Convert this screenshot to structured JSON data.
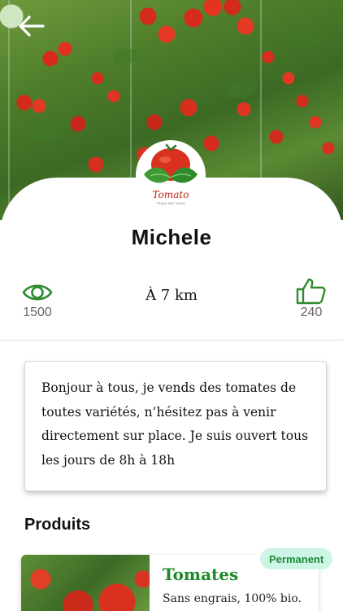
{
  "header": {
    "back_icon": "arrow-left-icon",
    "logo": {
      "brand": "Tomato",
      "tagline": "TRADLINE FARM"
    }
  },
  "profile": {
    "name": "Michele",
    "views_icon": "eye-icon",
    "views": "1500",
    "distance": "À 7 km",
    "likes_icon": "thumbs-up-icon",
    "likes": "240"
  },
  "description": {
    "lines": [
      "Bonjour à tous, je vends des tomates de",
      "toutes variétés, n’hésitez pas à venir",
      "directement sur place. Je suis ouvert tous",
      "les jours de 8h à 18h"
    ]
  },
  "products": {
    "title": "Produits",
    "items": [
      {
        "name": "Tomates",
        "description": "Sans engrais, 100% bio.",
        "badge": "Permanent"
      }
    ]
  },
  "colors": {
    "accent_green": "#1f8a2a",
    "badge_bg": "#cdf5e6",
    "muted_text": "#666666"
  }
}
